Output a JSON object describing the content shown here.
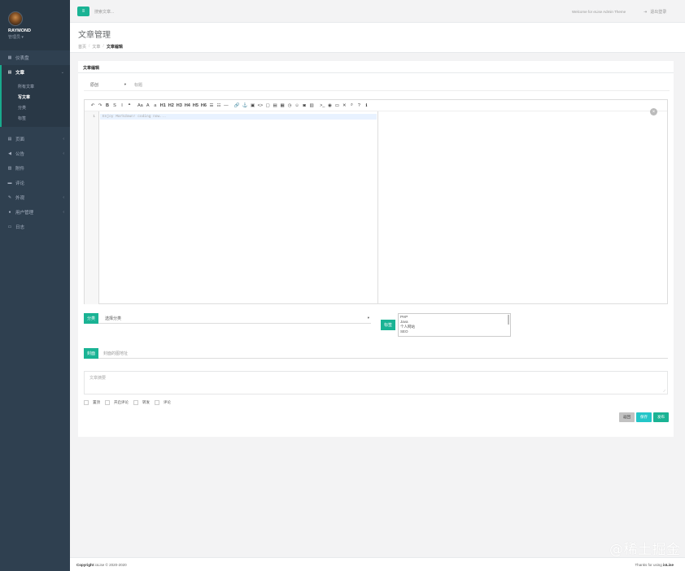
{
  "sidebar": {
    "user": {
      "name": "RAYMOND",
      "role": "管理员 ▾"
    },
    "items": [
      {
        "label": "仪表盘",
        "icon": "dashboard-icon",
        "glyph": "▦"
      },
      {
        "label": "文章",
        "icon": "document-icon",
        "glyph": "▤",
        "caret": "⌄"
      },
      {
        "label": "页面",
        "icon": "page-icon",
        "glyph": "▤",
        "caret": "‹"
      },
      {
        "label": "公告",
        "icon": "megaphone-icon",
        "glyph": "◀",
        "caret": "‹"
      },
      {
        "label": "附件",
        "icon": "image-icon",
        "glyph": "▨"
      },
      {
        "label": "评论",
        "icon": "comment-icon",
        "glyph": "▬"
      },
      {
        "label": "外观",
        "icon": "brush-icon",
        "glyph": "✎",
        "caret": "‹"
      },
      {
        "label": "用户管理",
        "icon": "user-icon",
        "glyph": "●",
        "caret": "‹"
      },
      {
        "label": "日志",
        "icon": "log-icon",
        "glyph": "▭"
      }
    ],
    "subitems": [
      "所有文章",
      "写文章",
      "分类",
      "标签"
    ]
  },
  "topbar": {
    "menu_glyph": "≡",
    "search_placeholder": "搜索文章...",
    "welcome": "Welcome for eLise Admin Theme",
    "logout": "退出登录",
    "logout_glyph": "⇥"
  },
  "heading": {
    "title": "文章管理",
    "breadcrumb": [
      "首页",
      "文章",
      "文章编辑"
    ],
    "sep": "/"
  },
  "card": {
    "title": "文章编辑",
    "type_value": "原创",
    "title_placeholder": "标题",
    "toolbar": [
      "↶",
      "↷",
      "B",
      "S",
      "I",
      "❝",
      "Aa",
      "A",
      "a",
      "H1",
      "H2",
      "H3",
      "H4",
      "H5",
      "H6",
      "☰",
      "☷",
      "—",
      "🔗",
      "⚓",
      "▣",
      "<>",
      "▢",
      "▤",
      "▦",
      "◷",
      "☺",
      "◙",
      "▥",
      ">_",
      "◉",
      "▭",
      "✕",
      "⌕",
      "?",
      "ℹ"
    ],
    "line_number": "1",
    "code_placeholder": "Enjoy Markdown! coding now...",
    "close_glyph": "×",
    "category_label": "分类",
    "category_value": "选择分类",
    "dropdown_glyph": "▾",
    "tags_label": "标签",
    "tags": [
      "PHP",
      "Java",
      "个人网站",
      "SEO"
    ],
    "thumb_label": "封面",
    "thumb_placeholder": "封面的图地址",
    "summary_placeholder": "文章摘要",
    "resize_glyph": "⟋",
    "checkboxes": [
      "置顶",
      "开启评论",
      "转发",
      "评论"
    ],
    "buttons": {
      "back": "返回",
      "save": "保存",
      "publish": "发布"
    }
  },
  "footer": {
    "copy_prefix": "Copyright",
    "copy_rest": "ioLise © 2020-2020",
    "thanks_prefix": "Thanks for using",
    "thanks_brand": "ioLise"
  },
  "watermark": "@稀土掘金技术社区",
  "colors": {
    "accent": "#1ab394",
    "sidebar": "#2f4050",
    "cyan": "#23c6c8"
  }
}
